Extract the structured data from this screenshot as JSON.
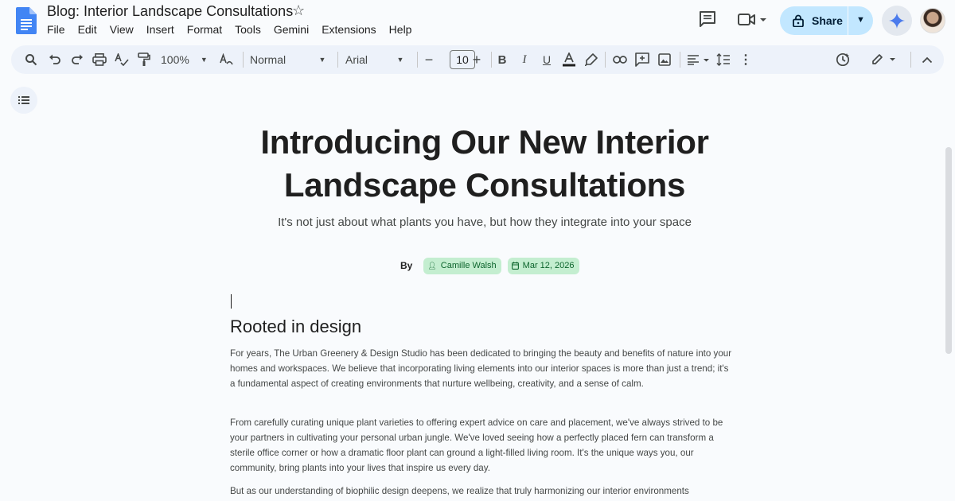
{
  "app": {
    "doc_title": "Blog: Interior Landscape Consultations",
    "menu": [
      "File",
      "Edit",
      "View",
      "Insert",
      "Format",
      "Tools",
      "Gemini",
      "Extensions",
      "Help"
    ],
    "share_label": "Share"
  },
  "toolbar": {
    "zoom": "100%",
    "style": "Normal",
    "font": "Arial",
    "font_size": "10"
  },
  "document": {
    "title": "Introducing Our New Interior Landscape Consultations",
    "subtitle": "It's not just about what plants you have, but how they integrate into your space",
    "by_label": "By",
    "author": "Camille Walsh",
    "date": "Mar 12, 2026",
    "heading": "Rooted in design",
    "paragraphs": [
      "For years, The Urban Greenery & Design Studio has been dedicated to bringing the beauty and benefits of nature into your homes and workspaces. We believe that incorporating living elements into our interior spaces is more than just a trend; it's a fundamental aspect of creating environments that nurture wellbeing, creativity, and a sense of calm.",
      "From carefully curating unique plant varieties to offering expert advice on care and placement, we've always strived to be your partners in cultivating your personal urban jungle. We've loved seeing how a perfectly placed fern can transform a sterile office corner or how a dramatic floor plant can ground a light-filled living room. It's the unique ways you, our community, bring plants into your lives that inspire us every day.",
      "But as our understanding of biophilic design deepens, we realize that truly harmonizing our interior environments"
    ]
  },
  "colors": {
    "share_bg": "#c2e7ff",
    "toolbar_bg": "#edf2fa",
    "chip_bg": "#c4eed0",
    "chip_text": "#0d652d",
    "docs_blue": "#4285f4"
  }
}
